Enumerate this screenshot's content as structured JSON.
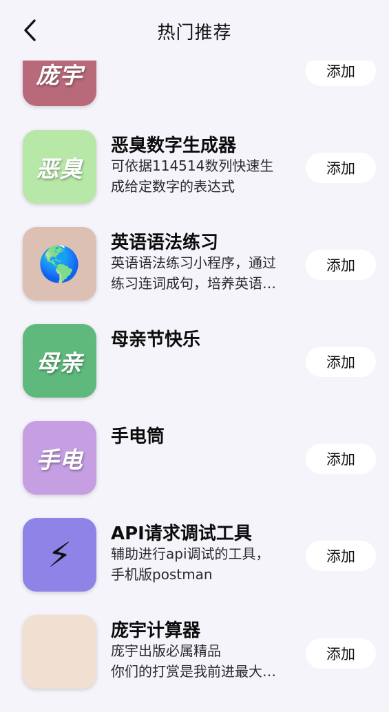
{
  "header": {
    "title": "热门推荐",
    "back_icon": "chevron-left-icon"
  },
  "items": [
    {
      "name": "",
      "desc1": "",
      "desc2": "",
      "icon_text": "庞宇",
      "icon_bg": "#b96a7a",
      "action": "添加"
    },
    {
      "name": "恶臭数字生成器",
      "desc1": "可依据114514数列快速生",
      "desc2": "成给定数字的表达式",
      "icon_text": "恶臭",
      "icon_bg": "#b8e8a8",
      "action": "添加"
    },
    {
      "name": "英语语法练习",
      "desc1": "英语语法练习小程序，通过",
      "desc2": "练习连词成句，培养英语…",
      "icon_emoji": "🌎",
      "icon_name": "globe-icon",
      "icon_bg": "#dcc0b4",
      "action": "添加"
    },
    {
      "name": "母亲节快乐",
      "desc1": "",
      "desc2": "",
      "icon_text": "母亲",
      "icon_bg": "#5fb97c",
      "action": "添加"
    },
    {
      "name": "手电筒",
      "desc1": "",
      "desc2": "",
      "icon_text": "手电",
      "icon_bg": "#c59fe2",
      "action": "添加"
    },
    {
      "name": "API请求调试工具",
      "desc1": "辅助进行api调试的工具，",
      "desc2": "手机版postman",
      "icon_emoji": "⚡",
      "icon_name": "lightning-icon",
      "icon_bg": "#8e84e8",
      "action": "添加"
    },
    {
      "name": "庞宇计算器",
      "desc1": "庞宇出版必属精品",
      "desc2": "你们的打赏是我前进最大…",
      "icon_text": "",
      "icon_bg": "#f1e0d2",
      "action": "添加"
    }
  ]
}
